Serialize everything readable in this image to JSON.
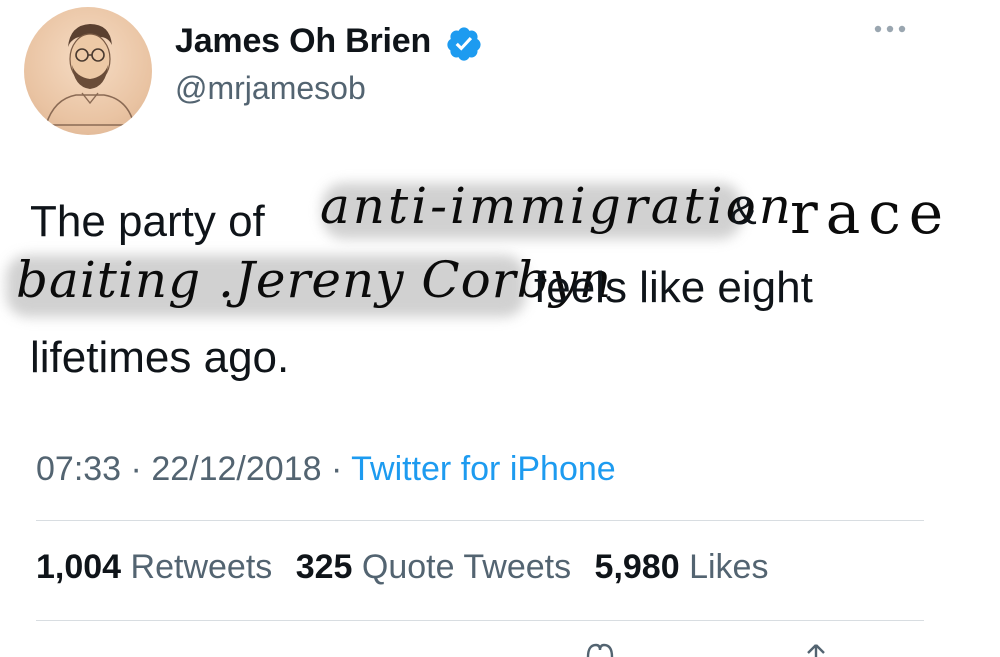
{
  "author": {
    "display_name": "James Oh Brien",
    "handle": "@mrjamesob",
    "verified": true
  },
  "tweet": {
    "line1_typed": "The party of",
    "line1_hand_a": "anti-immigration",
    "line1_amp": "&",
    "line1_hand_b": "race",
    "line2_hand": "baiting .Jereny Corbyn",
    "line2_typed": "feels like eight",
    "line3_typed": "lifetimes ago."
  },
  "meta": {
    "time": "07:33",
    "sep1": "·",
    "date": "22/12/2018",
    "sep2": "·",
    "source": "Twitter for iPhone"
  },
  "stats": {
    "retweets_count": "1,004",
    "retweets_label": "Retweets",
    "quotes_count": "325",
    "quotes_label": "Quote Tweets",
    "likes_count": "5,980",
    "likes_label": "Likes"
  },
  "colors": {
    "verified_blue": "#1d9bf0",
    "link_blue": "#1d9bf0",
    "secondary_text": "#536471",
    "primary_text": "#0f1419"
  },
  "icons": {
    "more": "more-horizontal-icon",
    "verified": "verified-badge-icon",
    "like": "heart-icon",
    "share": "share-icon"
  }
}
